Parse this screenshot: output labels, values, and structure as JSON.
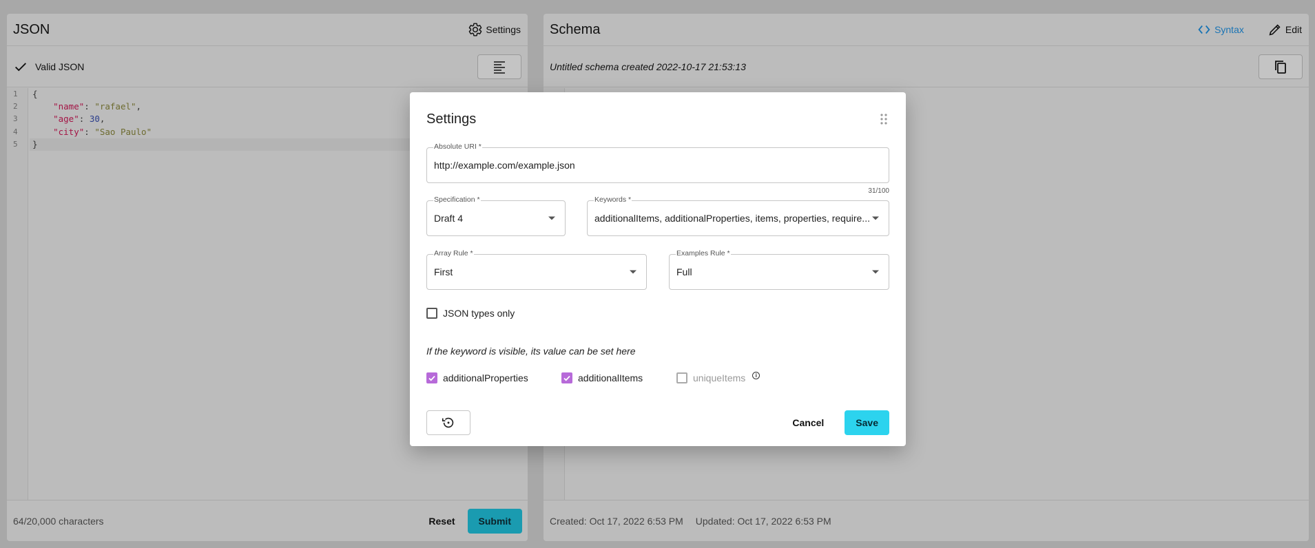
{
  "left_panel": {
    "title": "JSON",
    "settings_label": "Settings",
    "status": "Valid JSON",
    "line_numbers": [
      "1",
      "2",
      "3",
      "4",
      "5"
    ],
    "code": {
      "open": "{",
      "k1": "\"name\"",
      "v1": "\"rafael\"",
      "k2": "\"age\"",
      "v2": "30",
      "k3": "\"city\"",
      "v3": "\"Sao Paulo\"",
      "close": "}"
    },
    "char_count": "64/20,000 characters",
    "reset_label": "Reset",
    "submit_label": "Submit"
  },
  "right_panel": {
    "title": "Schema",
    "syntax_label": "Syntax",
    "edit_label": "Edit",
    "schema_name": "Untitled schema created 2022-10-17 21:53:13",
    "created": "Created: Oct 17, 2022 6:53 PM",
    "updated": "Updated: Oct 17, 2022 6:53 PM"
  },
  "modal": {
    "title": "Settings",
    "absolute_uri": {
      "label": "Absolute URI *",
      "value": "http://example.com/example.json",
      "counter": "31/100"
    },
    "specification": {
      "label": "Specification *",
      "value": "Draft 4"
    },
    "keywords": {
      "label": "Keywords *",
      "value": "additionalItems, additionalProperties, items, properties, require..."
    },
    "array_rule": {
      "label": "Array Rule *",
      "value": "First"
    },
    "examples_rule": {
      "label": "Examples Rule *",
      "value": "Full"
    },
    "json_types_only": {
      "label": "JSON types only",
      "checked": false
    },
    "hint": "If the keyword is visible, its value can be set here",
    "keyword_checks": [
      {
        "label": "additionalProperties",
        "checked": true
      },
      {
        "label": "additionalItems",
        "checked": true
      },
      {
        "label": "uniqueItems",
        "checked": false,
        "disabled": true
      }
    ],
    "info_glyph": "i",
    "cancel_label": "Cancel",
    "save_label": "Save"
  },
  "colors": {
    "accent": "#1a74b4",
    "checkbox": "#b76ad9",
    "save": "#2cd3ee",
    "submit": "#1a9bb0"
  }
}
